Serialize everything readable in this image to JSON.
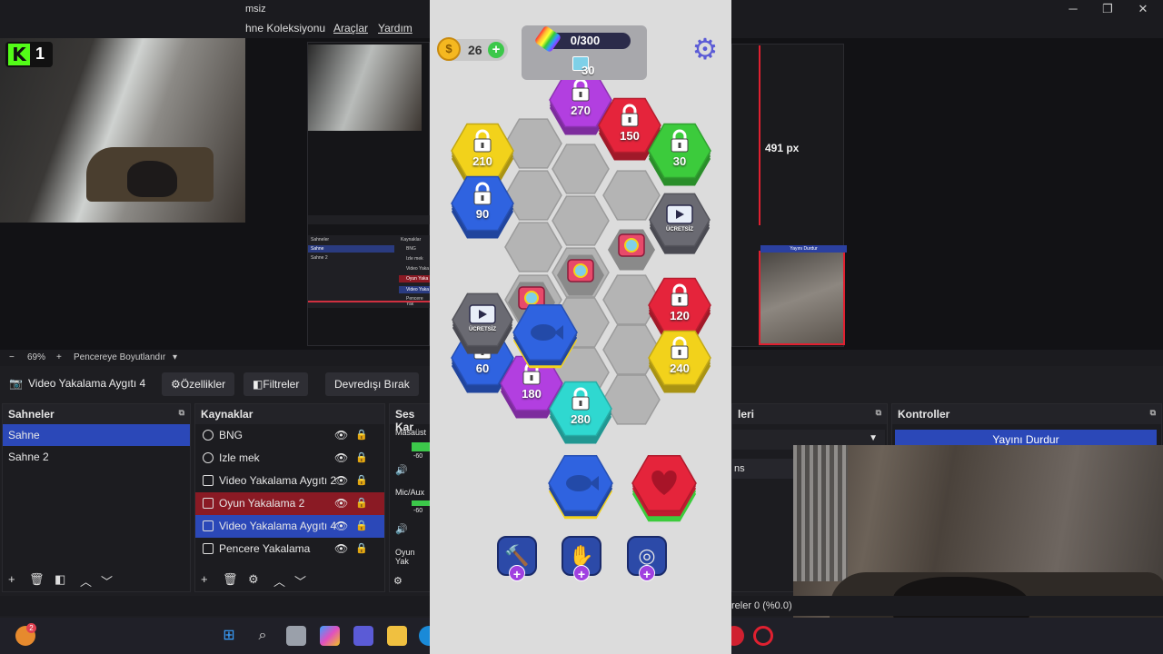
{
  "obs": {
    "window_title": "msiz",
    "menu": [
      "hne Koleksiyonu",
      "Araçlar",
      "Yardım"
    ],
    "overlay_number": "1",
    "mini_row_labels": [
      "Sahneler",
      "Kaynaklar",
      "Sahne",
      "Sahne 2",
      "BNG",
      "Izle mek",
      "Video Yaka",
      "Oyun Yaka",
      "Video Yaka",
      "Pencere Yak"
    ],
    "guide_label": "491 px",
    "red_box_strip": "Yayını Durdur",
    "zoom": {
      "minus": "−",
      "value": "69%",
      "plus": "+",
      "fit": "Pencereye Boyutlandır"
    },
    "source_bar": {
      "source_name": "Video Yakalama Aygıtı 4",
      "properties": "Özellikler",
      "filters": "Filtreler",
      "deactivate": "Devredışı Bırak"
    },
    "scenes": {
      "title": "Sahneler",
      "items": [
        "Sahne",
        "Sahne 2"
      ]
    },
    "sources": {
      "title": "Kaynaklar",
      "items": [
        {
          "label": "BNG",
          "state": "normal"
        },
        {
          "label": "Izle mek",
          "state": "normal"
        },
        {
          "label": "Video Yakalama Aygıtı 2",
          "state": "normal"
        },
        {
          "label": "Oyun Yakalama 2",
          "state": "red"
        },
        {
          "label": "Video Yakalama Aygıtı 4",
          "state": "selected"
        },
        {
          "label": "Pencere Yakalama",
          "state": "normal"
        }
      ]
    },
    "audio": {
      "title": "Ses Kar",
      "channels": [
        "Masaüst",
        "Mic/Aux",
        "Oyun Yak"
      ],
      "db": "-60"
    },
    "transitions": {
      "title": "leri",
      "item": "ns"
    },
    "controls": {
      "title": "Kontroller",
      "stream_button": "Yayını Durdur"
    },
    "status": {
      "frames": "reler 0 (%0.0)"
    }
  },
  "game": {
    "coins": "26",
    "progress": {
      "current": 0,
      "total": 300,
      "text": "0/300",
      "target": "30"
    },
    "tiles": [
      {
        "label": "270",
        "color": "#b23fe0"
      },
      {
        "label": "150",
        "color": "#e5243b"
      },
      {
        "label": "210",
        "color": "#f2d21b"
      },
      {
        "label": "30",
        "color": "#3ccb3c"
      },
      {
        "label": "90",
        "color": "#2f63e0"
      },
      {
        "label": "120",
        "color": "#e5243b"
      },
      {
        "label": "60",
        "color": "#2f63e0"
      },
      {
        "label": "240",
        "color": "#f2d21b"
      },
      {
        "label": "180",
        "color": "#b23fe0"
      },
      {
        "label": "280",
        "color": "#2fd8d0"
      }
    ],
    "free_label": "ÜCRETSİZ",
    "colors": {
      "panel": "#a8a8ac",
      "bar": "#2b2b4a",
      "gear": "#5b5bd6",
      "booster": "#2c4aa8"
    },
    "icons": [
      "coin-icon",
      "rainbow-icon",
      "gear-icon",
      "lock-icon",
      "camera-icon",
      "fish-icon",
      "heart-icon",
      "hand-icon"
    ]
  }
}
